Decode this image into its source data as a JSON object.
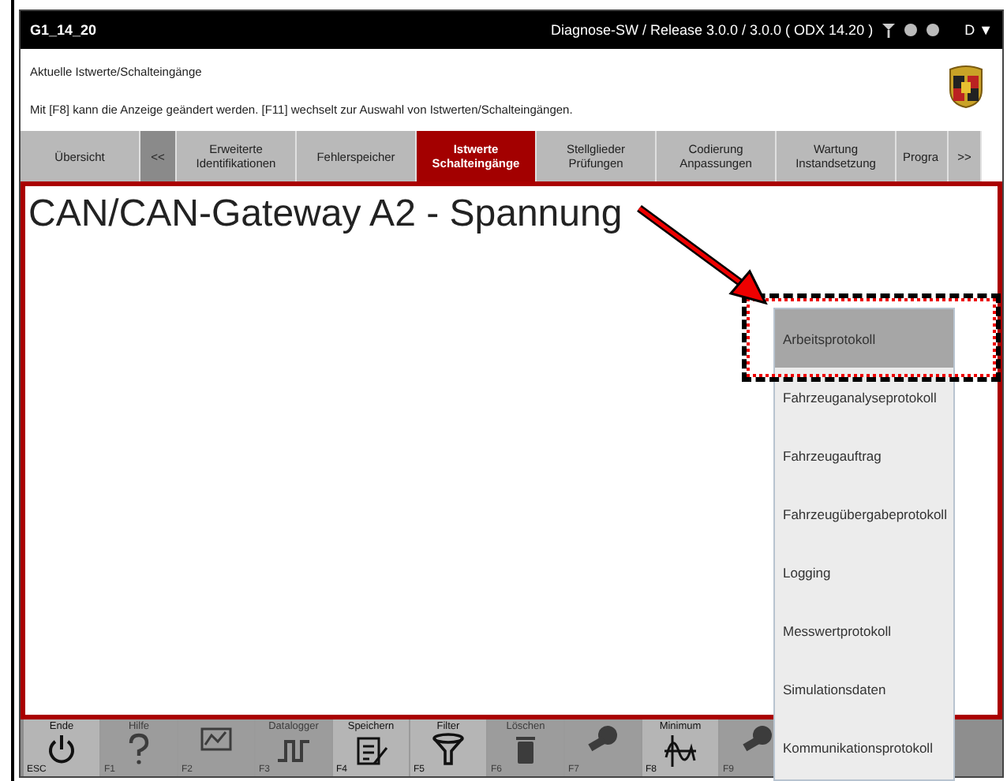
{
  "window": {
    "title": "G1_14_20",
    "version": "Diagnose-SW / Release 3.0.0 / 3.0.0  ( ODX   14.20 )",
    "language": "D ▼"
  },
  "header": {
    "title": "Aktuelle Istwerte/Schalteingänge",
    "hint": "Mit [F8] kann die Anzeige geändert werden. [F11] wechselt zur Auswahl von Istwerten/Schalteingängen."
  },
  "tabs": [
    {
      "label": "Übersicht",
      "kind": "tab",
      "selected": false
    },
    {
      "label": "<<",
      "kind": "nav",
      "selected": false
    },
    {
      "label": "Erweiterte Identifikationen",
      "kind": "tab",
      "selected": false
    },
    {
      "label": "Fehlerspeicher",
      "kind": "tab",
      "selected": false
    },
    {
      "label": "Istwerte Schalteingänge",
      "kind": "tab",
      "selected": true
    },
    {
      "label": "Stellglieder Prüfungen",
      "kind": "tab",
      "selected": false
    },
    {
      "label": "Codierung Anpassungen",
      "kind": "tab",
      "selected": false
    },
    {
      "label": "Wartung Instandsetzung",
      "kind": "tab",
      "selected": false
    },
    {
      "label": "Progra",
      "kind": "tab",
      "selected": false
    },
    {
      "label": ">>",
      "kind": "scroll",
      "selected": false
    }
  ],
  "content": {
    "heading": "CAN/CAN-Gateway A2 - Spannung"
  },
  "menu": [
    {
      "label": "Arbeitsprotokoll",
      "selected": true
    },
    {
      "label": "Fahrzeuganalyseprotokoll",
      "selected": false
    },
    {
      "label": "Fahrzeugauftrag",
      "selected": false
    },
    {
      "label": "Fahrzeugübergabeprotokoll",
      "selected": false
    },
    {
      "label": "Logging",
      "selected": false
    },
    {
      "label": "Messwertprotokoll",
      "selected": false
    },
    {
      "label": "Simulationsdaten",
      "selected": false
    },
    {
      "label": "Kommunikationsprotokoll",
      "selected": false
    }
  ],
  "function_keys": [
    {
      "label": "Ende",
      "key": "ESC",
      "kind": "power",
      "disabled": false
    },
    {
      "label": "Hilfe",
      "key": "F1",
      "kind": "help",
      "disabled": true
    },
    {
      "key": "F2",
      "kind": "chart",
      "disabled": true
    },
    {
      "label": "Datalogger",
      "key": "F3",
      "kind": "pulse",
      "disabled": true
    },
    {
      "label": "Speichern",
      "key": "F4",
      "kind": "clipboard",
      "disabled": false
    },
    {
      "label": "Filter",
      "key": "F5",
      "kind": "filter",
      "disabled": false
    },
    {
      "label": "Löschen",
      "key": "F6",
      "kind": "trash",
      "disabled": true
    },
    {
      "key": "F7",
      "kind": "tool",
      "disabled": true
    },
    {
      "label": "Minimum",
      "key": "F8",
      "kind": "wave",
      "disabled": false
    },
    {
      "key": "F9",
      "kind": "tool",
      "disabled": true
    }
  ]
}
